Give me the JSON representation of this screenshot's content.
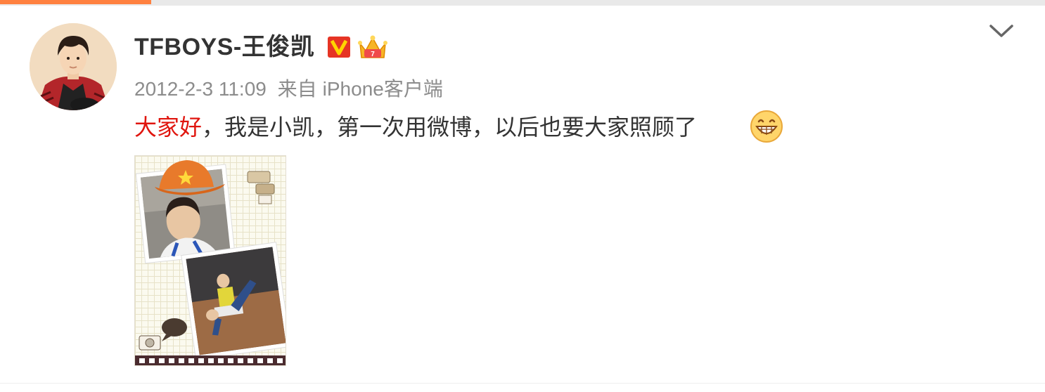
{
  "post": {
    "username": "TFBOYS-王俊凯",
    "timestamp": "2012-2-3 11:09",
    "source_prefix": "来自",
    "source_device": "iPhone客户端",
    "text_highlight": "大家好",
    "text_rest": "，我是小凯，第一次用微博，以后也要大家照顾了"
  },
  "icons": {
    "verified": "verified-v-icon",
    "crown": "crown-icon",
    "more": "chevron-down-icon",
    "emoji": "grin-emoji-icon"
  },
  "colors": {
    "accent": "#ff8140",
    "highlight": "#e0150e",
    "verified": "#e63424",
    "crown": "#f7b526"
  }
}
